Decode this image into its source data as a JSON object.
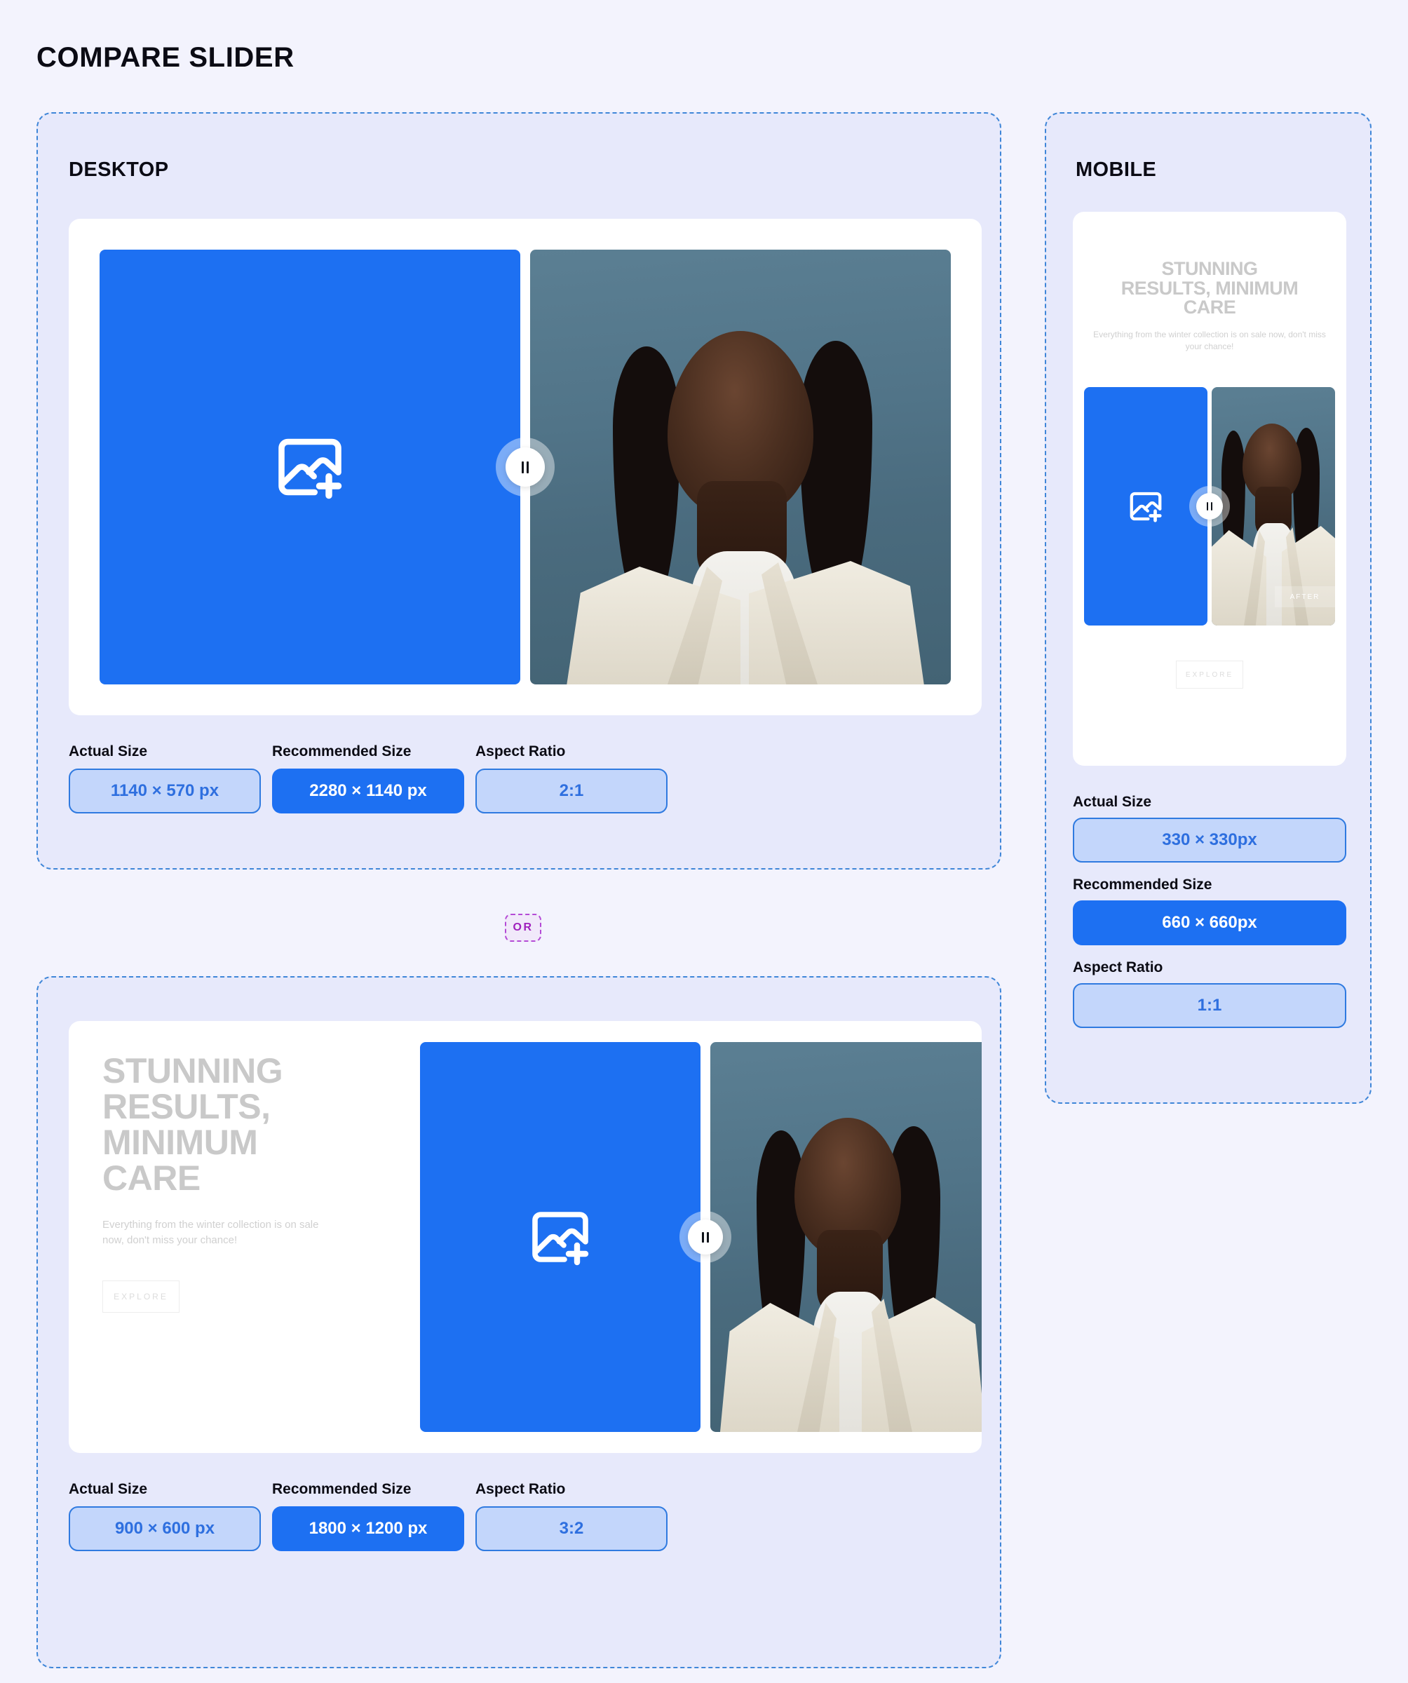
{
  "page": {
    "title": "COMPARE SLIDER",
    "or_divider_label": "OR",
    "accent_blue": "#1d70f2",
    "panel_bg": "#e7e9fb",
    "page_bg": "#f3f3fd",
    "dashed_border": "#3f86d8",
    "or_border": "#b44bd6"
  },
  "desktop_top": {
    "heading": "DESKTOP",
    "slider": {
      "before_icon": "add-image-icon",
      "handle_icon": "pause-bars-icon"
    },
    "specs": [
      {
        "label": "Actual Size",
        "value": "1140 × 570 px",
        "style": "outline"
      },
      {
        "label": "Recommended Size",
        "value": "2280 × 1140 px",
        "style": "solid"
      },
      {
        "label": "Aspect Ratio",
        "value": "2:1",
        "style": "outline"
      }
    ]
  },
  "desktop_bottom": {
    "hero": {
      "title_lines": [
        "STUNNING",
        "RESULTS,",
        "MINIMUM",
        "CARE"
      ],
      "subtitle": "Everything from the winter collection is on sale now, don't miss your chance!",
      "button": "EXPLORE"
    },
    "slider": {
      "before_icon": "add-image-icon",
      "handle_icon": "pause-bars-icon"
    },
    "specs": [
      {
        "label": "Actual Size",
        "value": "900 × 600 px",
        "style": "outline"
      },
      {
        "label": "Recommended Size",
        "value": "1800 × 1200 px",
        "style": "solid"
      },
      {
        "label": "Aspect Ratio",
        "value": "3:2",
        "style": "outline"
      }
    ]
  },
  "mobile": {
    "heading": "MOBILE",
    "hero": {
      "title_lines": [
        "STUNNING",
        "RESULTS, MINIMUM",
        "CARE"
      ],
      "subtitle": "Everything from the winter collection is on sale now, don't miss your chance!",
      "button": "EXPLORE"
    },
    "slider": {
      "before_icon": "add-image-icon",
      "handle_icon": "pause-bars-icon",
      "after_label": "AFTER"
    },
    "specs": [
      {
        "label": "Actual Size",
        "value": "330 × 330px",
        "style": "outline"
      },
      {
        "label": "Recommended Size",
        "value": "660 × 660px",
        "style": "solid"
      },
      {
        "label": "Aspect Ratio",
        "value": "1:1",
        "style": "outline"
      }
    ]
  }
}
